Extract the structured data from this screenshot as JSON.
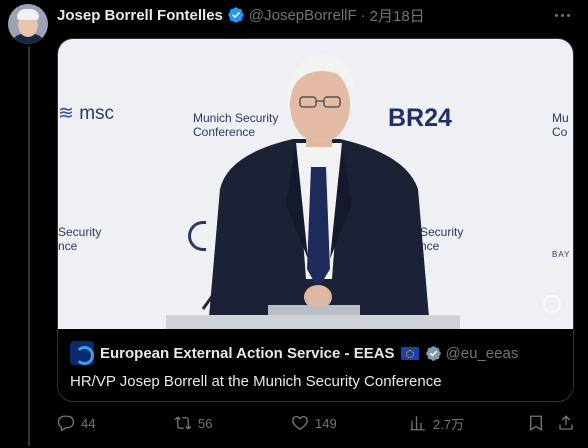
{
  "tweet": {
    "author_name": "Josep Borrell Fontelles",
    "author_handle": "@JosepBorrellF",
    "separator": "·",
    "date": "2月18日"
  },
  "media": {
    "backdrop": {
      "msc_logo": "msc",
      "center_text_line1": "Munich Security",
      "center_text_line2": "Conference",
      "br24": "BR24",
      "right_text_line1": "Mu",
      "right_text_line2": "Co",
      "lower_left_line1": "Security",
      "lower_left_line2": "nce",
      "lower_mid_line1": "Security",
      "lower_mid_line2": "nce",
      "bay": "BAY"
    }
  },
  "link_card": {
    "source_title": "European External Action Service - EEAS",
    "source_handle": "@eu_eeas",
    "description": "HR/VP Josep Borrell at the Munich Security Conference"
  },
  "actions": {
    "replies": "44",
    "retweets": "56",
    "likes": "149",
    "views": "2.7万"
  },
  "icons": {
    "verified": "verified-badge-icon",
    "more": "more-dots-icon",
    "reply": "reply-icon",
    "retweet": "retweet-icon",
    "like": "heart-icon",
    "views": "analytics-icon",
    "bookmark": "bookmark-icon",
    "share": "share-icon"
  },
  "colors": {
    "background": "#000000",
    "text_primary": "#e7e9ea",
    "text_secondary": "#71767b",
    "verified_blue": "#1d9bf0"
  }
}
